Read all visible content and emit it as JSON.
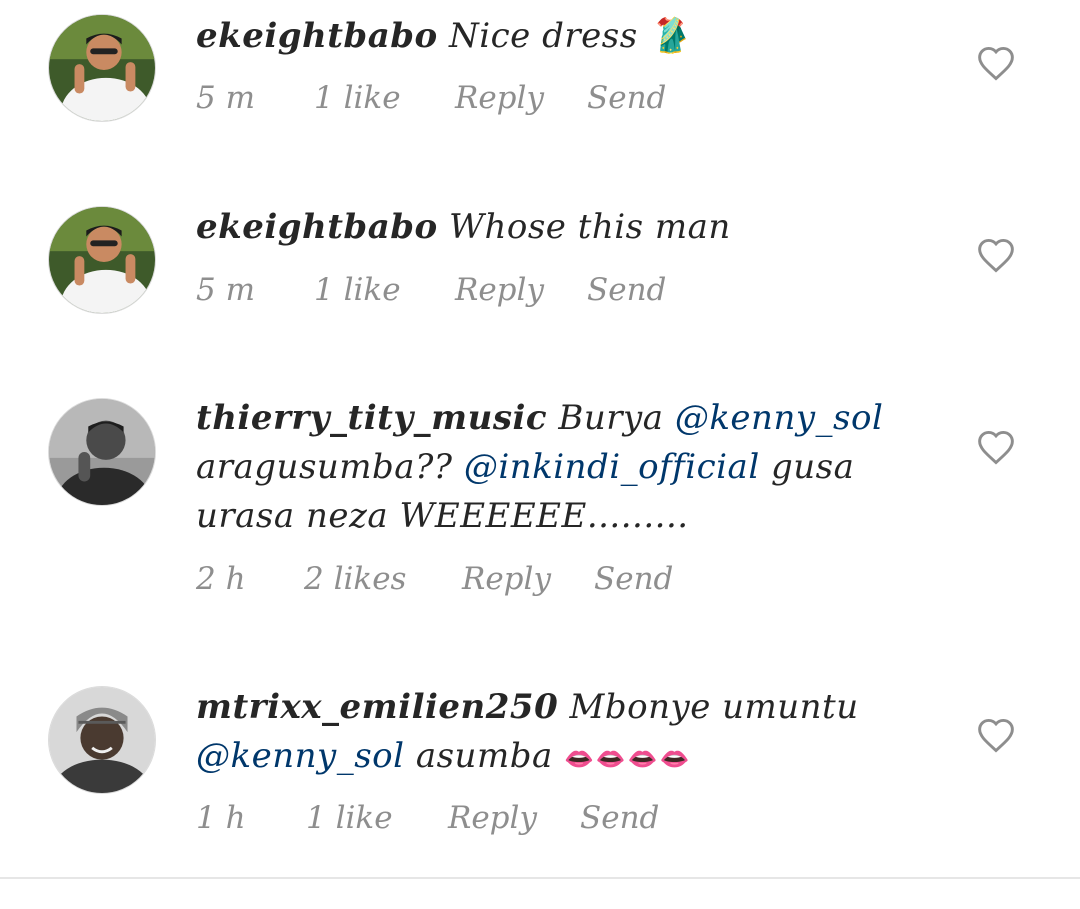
{
  "comments": [
    {
      "username": "ekeightbabo",
      "text_parts": [
        {
          "text": "Nice dress ",
          "type": "plain"
        },
        {
          "text": "🥻",
          "type": "emoji"
        }
      ],
      "time": "5 m",
      "likes": "1 like",
      "reply": "Reply",
      "send": "Send",
      "icon": "heart-outline-icon"
    },
    {
      "username": "ekeightbabo",
      "text_parts": [
        {
          "text": "Whose this man",
          "type": "plain"
        }
      ],
      "time": "5 m",
      "likes": "1 like",
      "reply": "Reply",
      "send": "Send",
      "icon": "heart-outline-icon"
    },
    {
      "username": "thierry_tity_music",
      "text_parts": [
        {
          "text": "Burya ",
          "type": "plain"
        },
        {
          "text": "@kenny_sol",
          "type": "mention"
        },
        {
          "text": " aragusumba?? ",
          "type": "plain"
        },
        {
          "text": "@inkindi_official",
          "type": "mention"
        },
        {
          "text": "  gusa urasa neza WEEEEEE.........",
          "type": "plain"
        }
      ],
      "time": "2 h",
      "likes": "2 likes",
      "reply": "Reply",
      "send": "Send",
      "icon": "heart-outline-icon"
    },
    {
      "username": "mtrixx_emilien250",
      "text_parts": [
        {
          "text": "Mbonye umuntu ",
          "type": "plain"
        },
        {
          "text": "@kenny_sol",
          "type": "mention"
        },
        {
          "text": "  asumba ",
          "type": "plain"
        },
        {
          "text": "👄👄👄👄",
          "type": "lips"
        }
      ],
      "time": "1 h",
      "likes": "1 like",
      "reply": "Reply",
      "send": "Send",
      "icon": "heart-outline-icon"
    }
  ],
  "colors": {
    "text": "#262626",
    "meta": "#8e8e8e",
    "mention": "#00376b",
    "lips": "#e23fb0"
  }
}
